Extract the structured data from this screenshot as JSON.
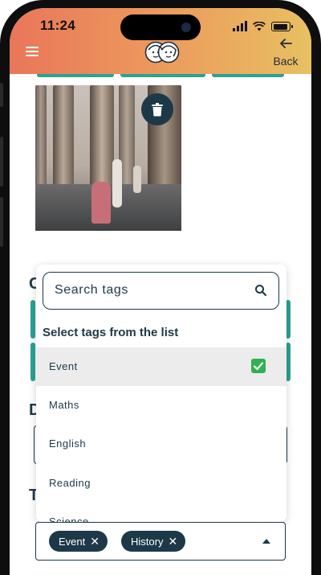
{
  "status_bar": {
    "time": "11:24",
    "signal_icon": "cellular-signal-icon",
    "wifi_icon": "wifi-icon",
    "battery_icon": "battery-icon",
    "battery_level": 0.85
  },
  "header": {
    "menu_icon": "hamburger-menu-icon",
    "logo": "two-children-faces-logo",
    "back_icon": "arrow-left-icon",
    "back_label": "Back",
    "colors": {
      "gradient_start": "#e9765a",
      "gradient_end": "#e8c062"
    }
  },
  "photo": {
    "delete_icon": "trash-icon"
  },
  "sections": {
    "c_label": "C",
    "d_label": "D",
    "t_label": "T"
  },
  "tag_dropdown": {
    "search_placeholder": "Search tags",
    "search_icon": "search-icon",
    "heading": "Select tags from the list",
    "options": [
      {
        "label": "Event",
        "selected": true
      },
      {
        "label": "Maths",
        "selected": false
      },
      {
        "label": "English",
        "selected": false
      },
      {
        "label": "Reading",
        "selected": false
      },
      {
        "label": "Science",
        "selected": false
      }
    ],
    "check_icon": "checkmark-icon"
  },
  "selected_tags": [
    {
      "label": "Event",
      "remove_icon": "close-icon"
    },
    {
      "label": "History",
      "remove_icon": "close-icon"
    }
  ],
  "colors": {
    "primary": "#1d3948",
    "accent_teal": "#2ba295",
    "check_green": "#2fb153"
  }
}
